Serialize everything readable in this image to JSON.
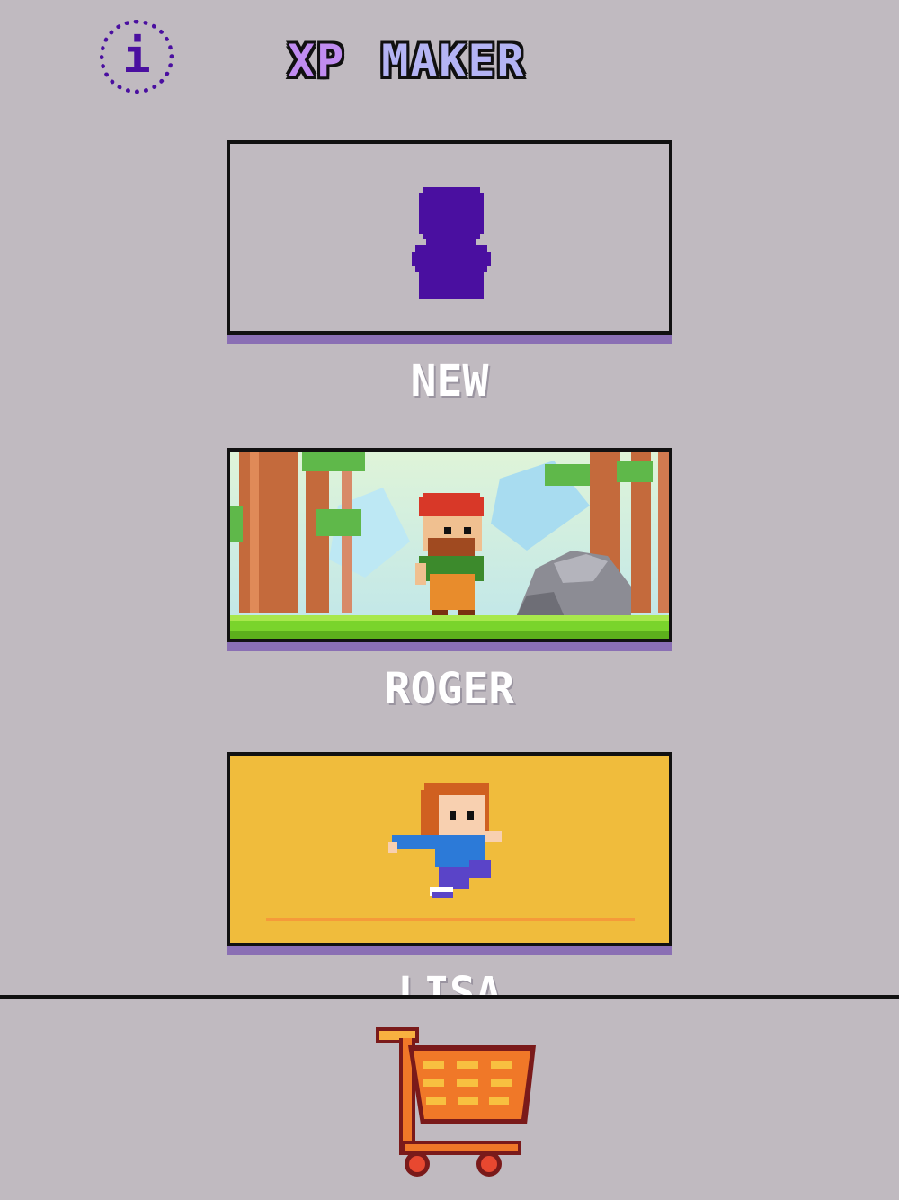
{
  "header": {
    "info_glyph": "i",
    "title_word_1": "XP",
    "title_word_2": "MAKER"
  },
  "characters": [
    {
      "name": "NEW",
      "background": "#c0bac0"
    },
    {
      "name": "ROGER",
      "background": "forest"
    },
    {
      "name": "LISA",
      "background": "#f0bc3c"
    }
  ],
  "footer": {
    "cart_icon": "shopping-cart-icon"
  },
  "colors": {
    "page_bg": "#c0bac0",
    "accent_purple": "#4a0fa0",
    "card_shadow": "#8a6fb4",
    "cart_orange": "#f07828"
  }
}
